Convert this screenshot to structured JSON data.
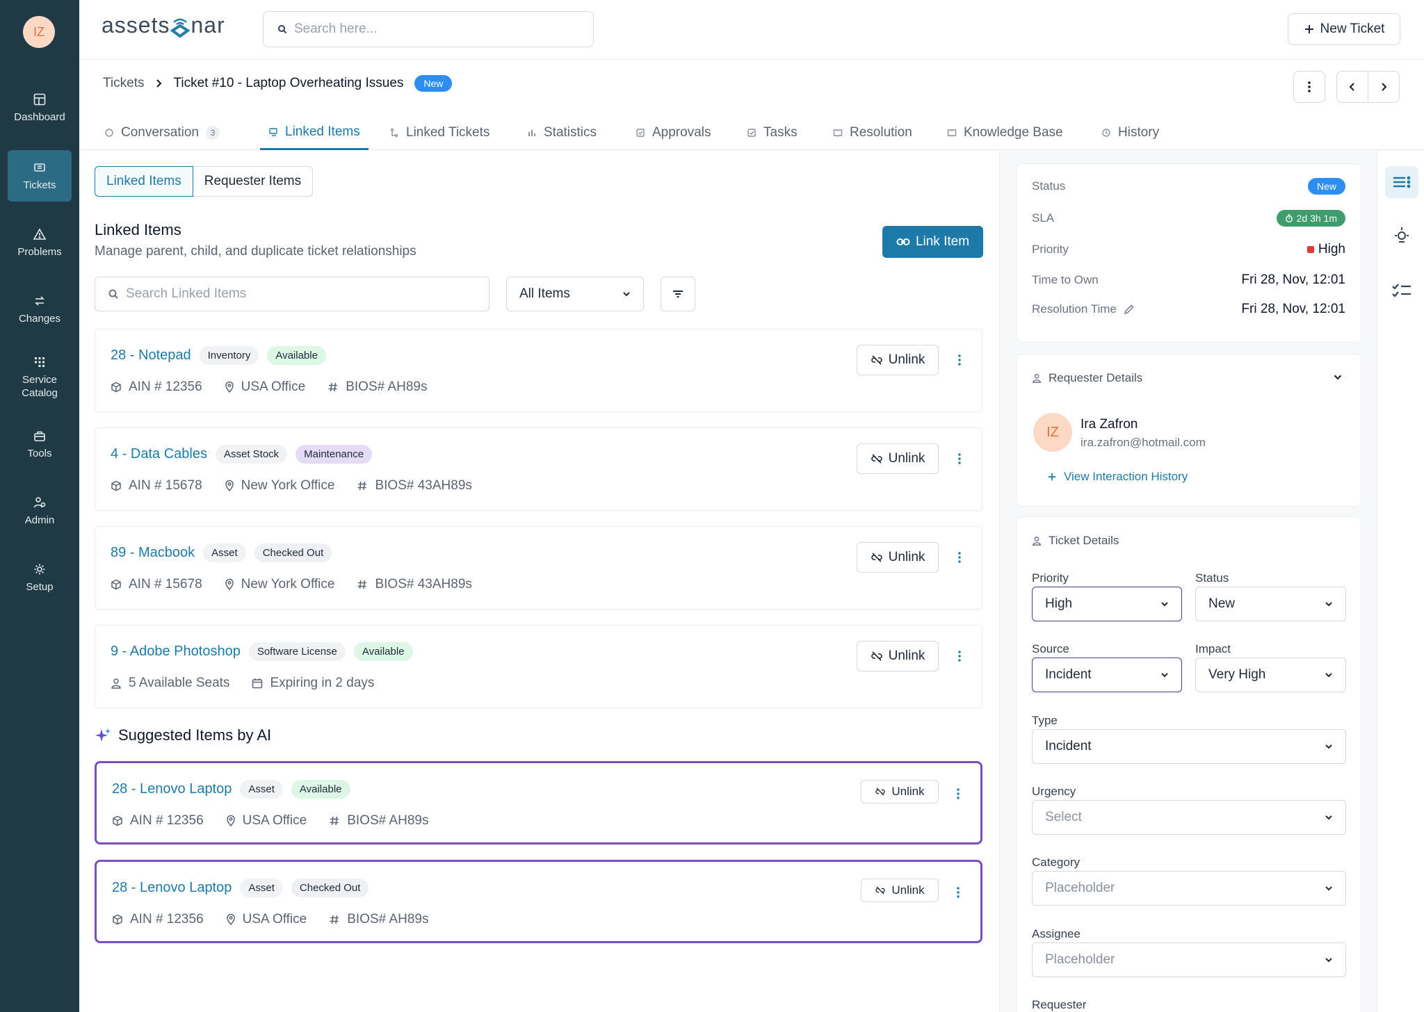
{
  "user": {
    "initials": "IZ"
  },
  "nav": [
    {
      "label": "Dashboard",
      "icon": "dashboard-icon"
    },
    {
      "label": "Tickets",
      "icon": "ticket-icon",
      "active": true
    },
    {
      "label": "Problems",
      "icon": "warning-icon"
    },
    {
      "label": "Changes",
      "icon": "swap-icon"
    },
    {
      "label": "Service Catalog",
      "icon": "grid-icon"
    },
    {
      "label": "Tools",
      "icon": "toolbox-icon"
    },
    {
      "label": "Admin",
      "icon": "admin-icon"
    },
    {
      "label": "Setup",
      "icon": "gear-icon"
    }
  ],
  "header": {
    "logo_left": "assets",
    "logo_mid": "o",
    "logo_right": "nar",
    "search_placeholder": "Search here...",
    "new_ticket": "New Ticket"
  },
  "breadcrumb": {
    "root": "Tickets",
    "current": "Ticket #10 - Laptop Overheating Issues",
    "badge": "New"
  },
  "tabs": [
    {
      "label": "Conversation",
      "count": "3"
    },
    {
      "label": "Linked Items",
      "active": true
    },
    {
      "label": "Linked Tickets"
    },
    {
      "label": "Statistics"
    },
    {
      "label": "Approvals"
    },
    {
      "label": "Tasks"
    },
    {
      "label": "Resolution"
    },
    {
      "label": "Knowledge Base"
    },
    {
      "label": "History"
    }
  ],
  "segment": {
    "on": "Linked Items",
    "off": "Requester Items"
  },
  "section": {
    "title": "Linked Items",
    "subtitle": "Manage parent, child, and duplicate ticket relationships",
    "link_button": "Link Item",
    "search_placeholder": "Search Linked Items",
    "filter_value": "All Items"
  },
  "items": [
    {
      "name": "28 - Notepad",
      "type": "Inventory",
      "status": "Available",
      "status_color": "green",
      "meta": [
        {
          "icon": "box-icon",
          "text": "AIN # 12356"
        },
        {
          "icon": "location-icon",
          "text": "USA Office"
        },
        {
          "icon": "hash-icon",
          "text": "BIOS# AH89s"
        }
      ]
    },
    {
      "name": "4 - Data Cables",
      "type": "Asset Stock",
      "status": "Maintenance",
      "status_color": "purple",
      "meta": [
        {
          "icon": "box-icon",
          "text": "AIN # 15678"
        },
        {
          "icon": "location-icon",
          "text": "New York Office"
        },
        {
          "icon": "hash-icon",
          "text": "BIOS# 43AH89s"
        }
      ]
    },
    {
      "name": "89 - Macbook",
      "type": "Asset",
      "status": "Checked Out",
      "status_color": "gray",
      "meta": [
        {
          "icon": "box-icon",
          "text": "AIN # 15678"
        },
        {
          "icon": "location-icon",
          "text": "New York Office"
        },
        {
          "icon": "hash-icon",
          "text": "BIOS# 43AH89s"
        }
      ]
    },
    {
      "name": "9 - Adobe Photoshop",
      "type": "Software License",
      "status": "Available",
      "status_color": "green",
      "meta": [
        {
          "icon": "user-icon",
          "text": "5 Available Seats"
        },
        {
          "icon": "calendar-icon",
          "text": "Expiring in 2 days"
        }
      ]
    }
  ],
  "unlink_label": "Unlink",
  "ai": {
    "title": "Suggested Items by AI",
    "items": [
      {
        "name": "28 - Lenovo Laptop",
        "type": "Asset",
        "status": "Available",
        "status_color": "green",
        "meta": [
          {
            "icon": "box-icon",
            "text": "AIN # 12356"
          },
          {
            "icon": "location-icon",
            "text": "USA Office"
          },
          {
            "icon": "hash-icon",
            "text": "BIOS# AH89s"
          }
        ]
      },
      {
        "name": "28 - Lenovo Laptop",
        "type": "Asset",
        "status": "Checked Out",
        "status_color": "gray",
        "meta": [
          {
            "icon": "box-icon",
            "text": "AIN # 12356"
          },
          {
            "icon": "location-icon",
            "text": "USA Office"
          },
          {
            "icon": "hash-icon",
            "text": "BIOS# AH89s"
          }
        ]
      }
    ]
  },
  "summary": {
    "status_label": "Status",
    "status_value": "New",
    "sla_label": "SLA",
    "sla_value": "2d 3h 1m",
    "priority_label": "Priority",
    "priority_value": "High",
    "tto_label": "Time to Own",
    "tto_value": "Fri 28, Nov, 12:01",
    "rt_label": "Resolution Time",
    "rt_value": "Fri 28, Nov, 12:01"
  },
  "requester": {
    "title": "Requester Details",
    "initials": "IZ",
    "name": "Ira Zafron",
    "email": "ira.zafron@hotmail.com",
    "history_link": "View Interaction History"
  },
  "ticket_details": {
    "title": "Ticket Details",
    "priority_label": "Priority",
    "priority_value": "High",
    "status_label": "Status",
    "status_value": "New",
    "source_label": "Source",
    "source_value": "Incident",
    "impact_label": "Impact",
    "impact_value": "Very High",
    "type_label": "Type",
    "type_value": "Incident",
    "urgency_label": "Urgency",
    "urgency_value": "Select",
    "category_label": "Category",
    "category_value": "Placeholder",
    "assignee_label": "Assignee",
    "assignee_value": "Placeholder",
    "requester_label": "Requester"
  },
  "colors": {
    "sidebar": "#1f3a45",
    "accent": "#1d7aa8",
    "ai_border": "#7b4fc2",
    "badge_blue": "#2b8ef0",
    "sla_green": "#3e9c6d"
  }
}
